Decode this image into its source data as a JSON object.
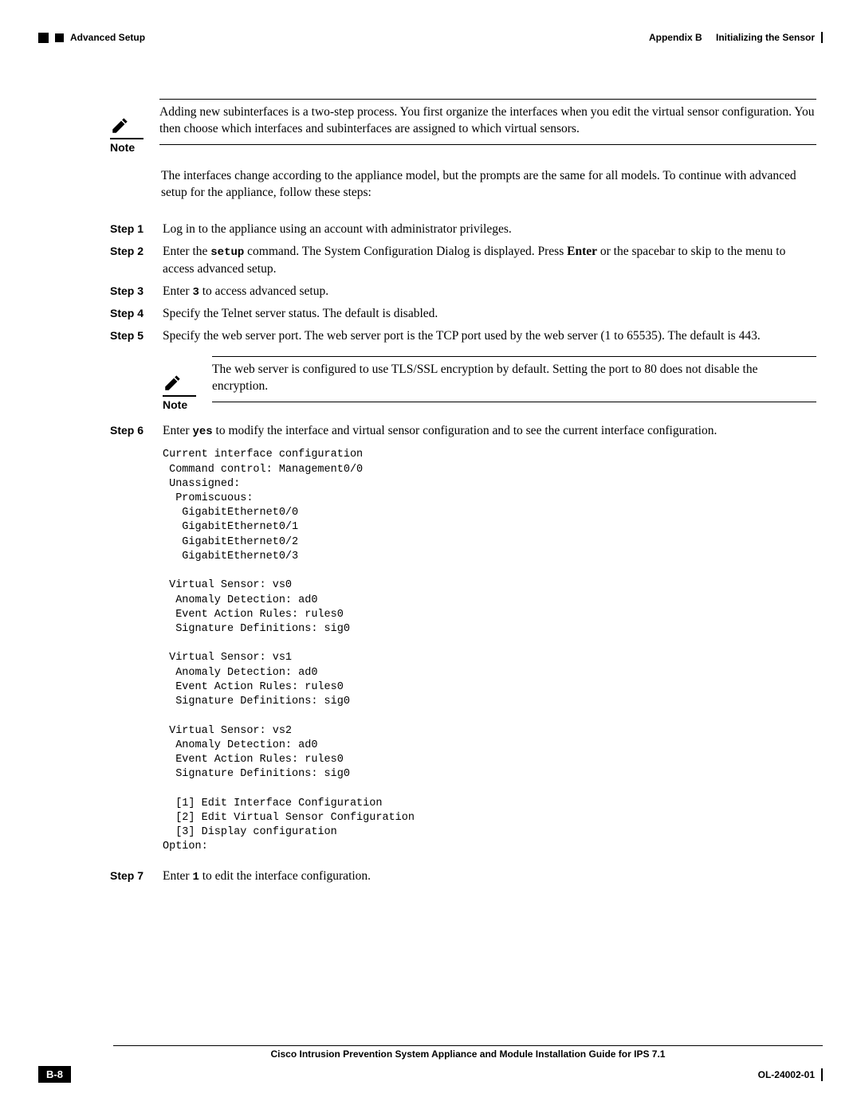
{
  "header": {
    "left": "Advanced Setup",
    "right_appendix": "Appendix B",
    "right_title": "Initializing the Sensor"
  },
  "note1": {
    "label": "Note",
    "text": "Adding new subinterfaces is a two-step process. You first organize the interfaces when you edit the virtual sensor configuration. You then choose which interfaces and subinterfaces are assigned to which virtual sensors."
  },
  "intro_para": "The interfaces change according to the appliance model, but the prompts are the same for all models. To continue with advanced setup for the appliance, follow these steps:",
  "steps": {
    "s1": {
      "label": "Step 1",
      "text": "Log in to the appliance using an account with administrator privileges."
    },
    "s2": {
      "label": "Step 2",
      "pre": "Enter the ",
      "cmd": "setup",
      "mid": " command. The System Configuration Dialog is displayed. Press ",
      "key": "Enter",
      "post": " or the spacebar to skip to the menu to access advanced setup."
    },
    "s3": {
      "label": "Step 3",
      "pre": "Enter ",
      "cmd": "3",
      "post": " to access advanced setup."
    },
    "s4": {
      "label": "Step 4",
      "text": "Specify the Telnet server status. The default is disabled."
    },
    "s5": {
      "label": "Step 5",
      "text": "Specify the web server port. The web server port is the TCP port used by the web server (1 to 65535). The default is 443."
    },
    "s6": {
      "label": "Step 6",
      "pre": "Enter ",
      "cmd": "yes",
      "post": " to modify the interface and virtual sensor configuration and to see the current interface configuration."
    },
    "s7": {
      "label": "Step 7",
      "pre": "Enter ",
      "cmd": "1",
      "post": " to edit the interface configuration."
    }
  },
  "note2": {
    "label": "Note",
    "text": "The web server is configured to use TLS/SSL encryption by default. Setting the port to 80 does not disable the encryption."
  },
  "code": "Current interface configuration\n Command control: Management0/0\n Unassigned:\n  Promiscuous:\n   GigabitEthernet0/0\n   GigabitEthernet0/1\n   GigabitEthernet0/2\n   GigabitEthernet0/3\n\n Virtual Sensor: vs0\n  Anomaly Detection: ad0\n  Event Action Rules: rules0\n  Signature Definitions: sig0\n\n Virtual Sensor: vs1\n  Anomaly Detection: ad0\n  Event Action Rules: rules0\n  Signature Definitions: sig0\n\n Virtual Sensor: vs2\n  Anomaly Detection: ad0\n  Event Action Rules: rules0\n  Signature Definitions: sig0\n\n  [1] Edit Interface Configuration\n  [2] Edit Virtual Sensor Configuration\n  [3] Display configuration\nOption:",
  "footer": {
    "title": "Cisco Intrusion Prevention System Appliance and Module Installation Guide for IPS 7.1",
    "page": "B-8",
    "doc_id": "OL-24002-01"
  }
}
